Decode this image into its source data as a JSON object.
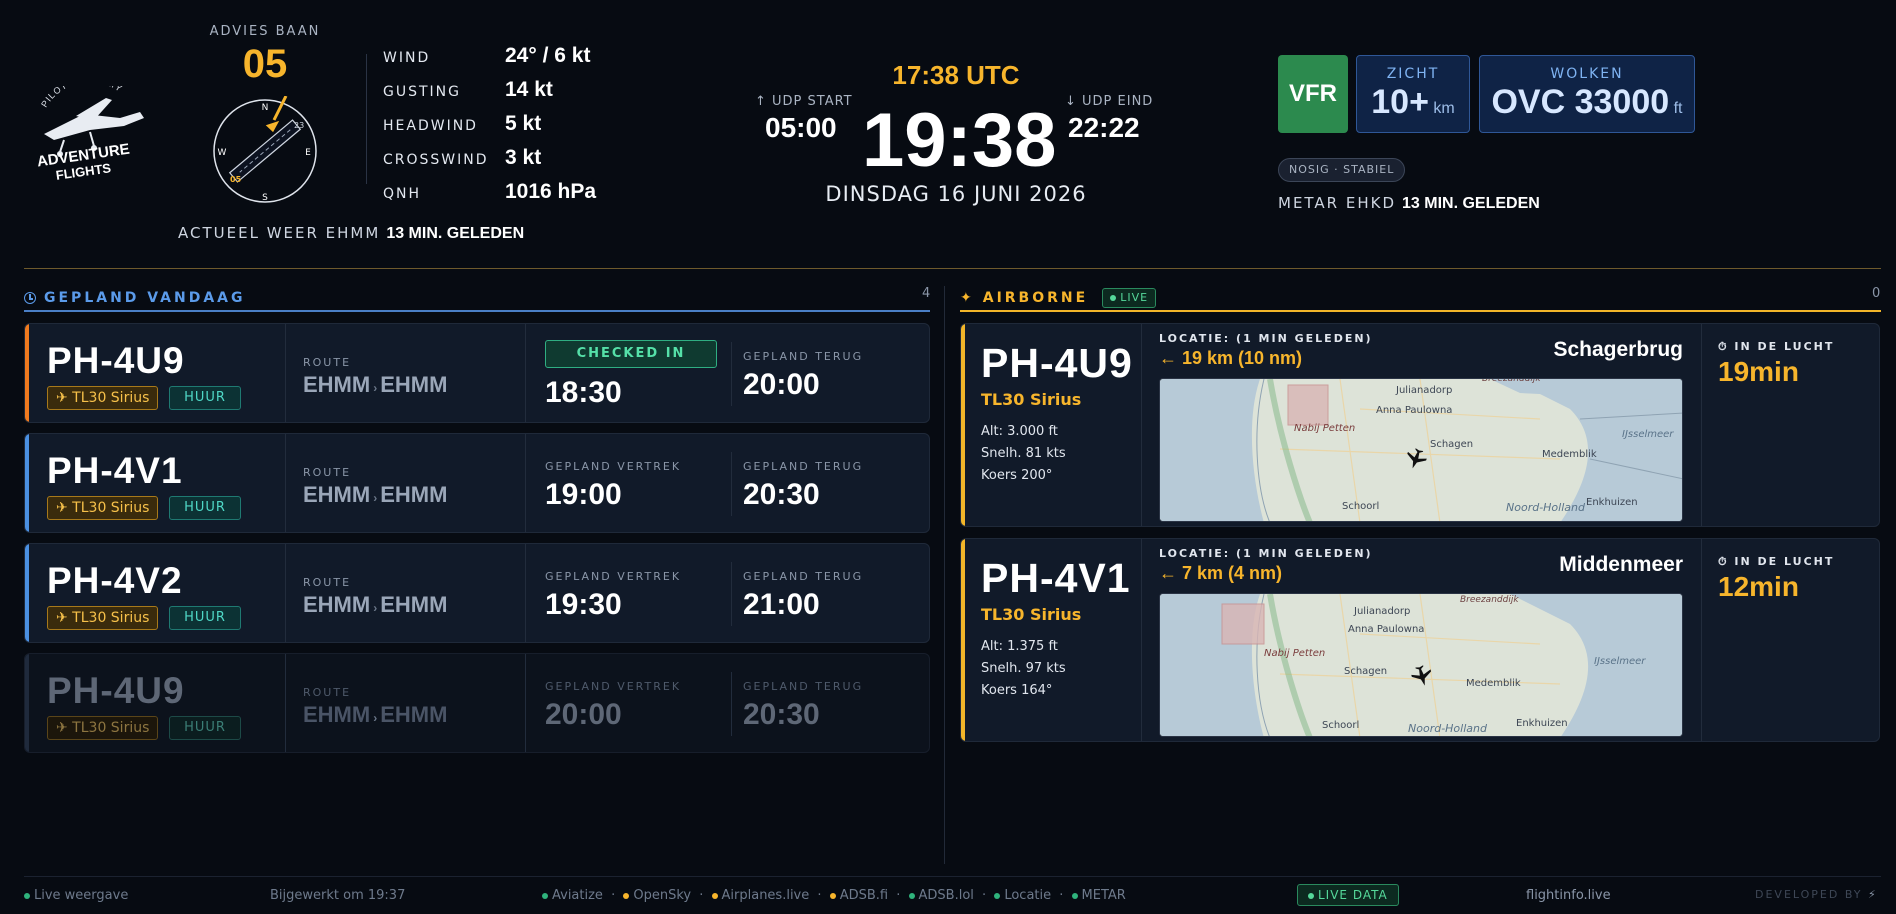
{
  "header": {
    "runway": {
      "label": "ADVIES BAAN",
      "number": "05"
    },
    "compass": {
      "n": "N",
      "e": "E",
      "s": "S",
      "w": "W",
      "rwy_a": "05",
      "rwy_b": "23"
    },
    "weather": {
      "rows": [
        {
          "key": "WIND",
          "value": "24° / 6 kt"
        },
        {
          "key": "GUSTING",
          "value": "14 kt"
        },
        {
          "key": "HEADWIND",
          "value": "5 kt"
        },
        {
          "key": "CROSSWIND",
          "value": "3 kt"
        },
        {
          "key": "QNH",
          "value": "1016 hPa"
        }
      ],
      "footer_label": "ACTUEEL WEER EHMM",
      "footer_time": "13 MIN. GELEDEN"
    },
    "logo": {
      "top": "PILOT ACADEMY",
      "mid": "ADVENTURE",
      "bottom": "FLIGHTS"
    },
    "clock": {
      "udp_start_label": "↑ UDP START",
      "udp_start": "05:00",
      "utc": "17:38 UTC",
      "local": "19:38",
      "date": "DINSDAG 16 JUNI 2026",
      "udp_end_label": "↓ UDP EIND",
      "udp_end": "22:22"
    },
    "metar": {
      "category": "VFR",
      "visibility_label": "ZICHT",
      "visibility_value": "10+",
      "visibility_unit": "km",
      "clouds_label": "WOLKEN",
      "clouds_value": "OVC 33000",
      "clouds_unit": "ft",
      "trend": "NOSIG · STABIEL",
      "footer_label": "METAR EHKD",
      "footer_time": "13 MIN. GELEDEN"
    }
  },
  "planned": {
    "title": "GEPLAND VANDAAG",
    "count": "4",
    "route_label": "ROUTE",
    "dep_label": "GEPLAND VERTREK",
    "ret_label": "GEPLAND TERUG",
    "flights": [
      {
        "reg": "PH-4U9",
        "type": "✈ TL30 Sirius",
        "tag": "HUUR",
        "from": "EHMM",
        "sep": "›",
        "to": "EHMM",
        "status": "CHECKED IN",
        "dep": "18:30",
        "ret": "20:00"
      },
      {
        "reg": "PH-4V1",
        "type": "✈ TL30 Sirius",
        "tag": "HUUR",
        "from": "EHMM",
        "sep": "›",
        "to": "EHMM",
        "status": "",
        "dep": "19:00",
        "ret": "20:30"
      },
      {
        "reg": "PH-4V2",
        "type": "✈ TL30 Sirius",
        "tag": "HUUR",
        "from": "EHMM",
        "sep": "›",
        "to": "EHMM",
        "status": "",
        "dep": "19:30",
        "ret": "21:00"
      },
      {
        "reg": "PH-4U9",
        "type": "✈ TL30 Sirius",
        "tag": "HUUR",
        "from": "EHMM",
        "sep": "›",
        "to": "EHMM",
        "status": "",
        "dep": "20:00",
        "ret": "20:30"
      }
    ]
  },
  "airborne": {
    "title": "AIRBORNE",
    "live": "LIVE",
    "count": "0",
    "location_label": "LOCATIE: (1 MIN GELEDEN)",
    "air_label": "IN DE LUCHT",
    "flights": [
      {
        "reg": "PH-4U9",
        "type": "TL30 Sirius",
        "alt": "Alt: 3.000 ft",
        "speed": "Snelh. 81 kts",
        "heading": "Koers 200°",
        "distance": "← 19 km (10 nm)",
        "town": "Schagerbrug",
        "airtime": "19min"
      },
      {
        "reg": "PH-4V1",
        "type": "TL30 Sirius",
        "alt": "Alt: 1.375 ft",
        "speed": "Snelh. 97 kts",
        "heading": "Koers 164°",
        "distance": "← 7 km (4 nm)",
        "town": "Middenmeer",
        "airtime": "12min"
      }
    ],
    "map_labels": {
      "breezanddijk": "Breezanddijk",
      "julianadorp": "Julianadorp",
      "anna_paulowna": "Anna Paulowna",
      "nabij_petten": "Nabij Petten",
      "schagen": "Schagen",
      "medemblik": "Medemblik",
      "ijsselmeer": "IJsselmeer",
      "schoorl": "Schoorl",
      "noord_holland": "Noord-Holland",
      "enkhuizen": "Enkhuizen"
    }
  },
  "footer": {
    "live_view": "Live weergave",
    "updated": "Bijgewerkt om 19:37",
    "sources": [
      "Aviatize",
      "OpenSky",
      "Airplanes.live",
      "ADSB.fi",
      "ADSB.lol",
      "Locatie",
      "METAR"
    ],
    "live_data": "LIVE DATA",
    "site": "flightinfo.live",
    "developed": "DEVELOPED BY"
  },
  "colors": {
    "accent": "#f7b52c",
    "planned_blue": "#4a90e2",
    "planned_orange": "#f07a1e",
    "vfr_green": "#2c8a4e",
    "teal": "#4fd8c6",
    "background": "#070b12"
  }
}
